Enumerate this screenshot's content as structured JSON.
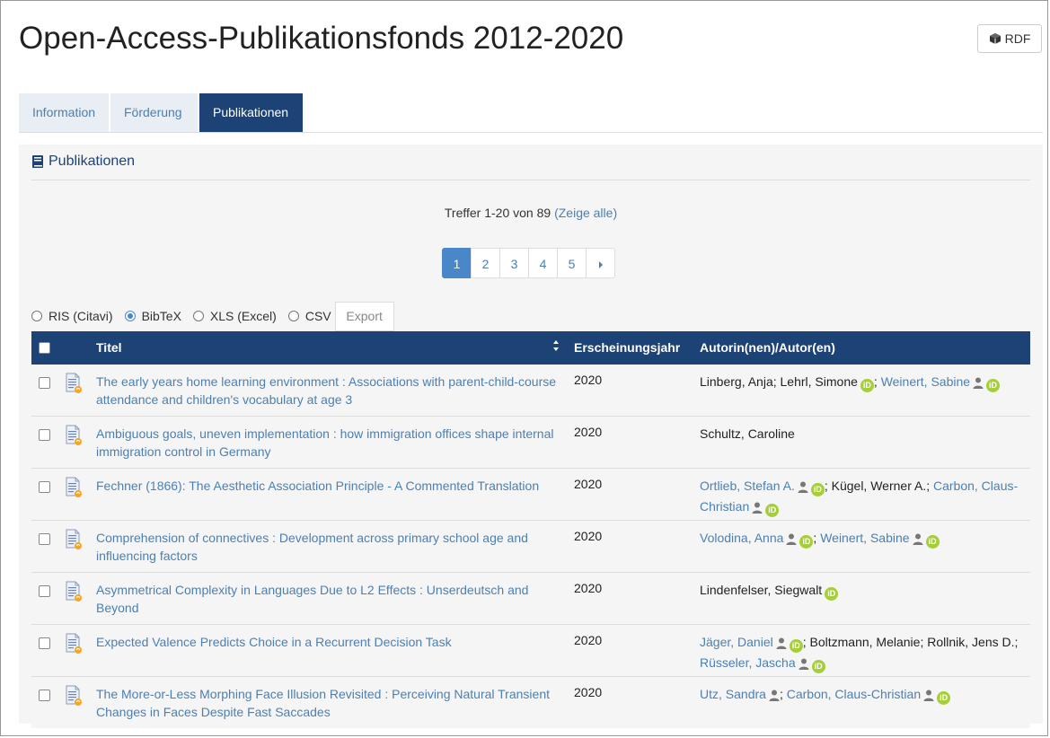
{
  "header": {
    "title": "Open-Access-Publikationsfonds 2012-2020",
    "rdf_label": "RDF"
  },
  "tabs": [
    {
      "label": "Information",
      "active": false
    },
    {
      "label": "Förderung",
      "active": false
    },
    {
      "label": "Publikationen",
      "active": true
    }
  ],
  "panel": {
    "heading": "Publikationen",
    "hits_text": "Treffer 1-20 von 89",
    "show_all": "(Zeige alle)"
  },
  "pagination": {
    "pages": [
      "1",
      "2",
      "3",
      "4",
      "5"
    ],
    "current": "1",
    "next_icon": "caret-right-icon"
  },
  "export": {
    "options": [
      "RIS (Citavi)",
      "BibTeX",
      "XLS (Excel)",
      "CSV"
    ],
    "selected": "BibTeX",
    "button_label": "Export"
  },
  "table": {
    "columns": [
      "Titel",
      "Erscheinungsjahr",
      "Autorin(nen)/Autor(en)"
    ],
    "rows": [
      {
        "title": "The early years home learning environment : Associations with parent-child-course attendance and children's vocabulary at age 3",
        "year": "2020",
        "authors": [
          {
            "name": "Linberg, Anja",
            "link": false,
            "person": false,
            "orcid": false
          },
          {
            "name": "Lehrl, Simone",
            "link": false,
            "person": false,
            "orcid": true
          },
          {
            "name": "Weinert, Sabine",
            "link": true,
            "person": true,
            "orcid": true
          }
        ]
      },
      {
        "title": "Ambiguous goals, uneven implementation : how immigration offices shape internal immigration control in Germany",
        "year": "2020",
        "authors": [
          {
            "name": "Schultz, Caroline",
            "link": false,
            "person": false,
            "orcid": false
          }
        ]
      },
      {
        "title": "Fechner (1866): The Aesthetic Association Principle - A Commented Translation",
        "year": "2020",
        "authors": [
          {
            "name": "Ortlieb, Stefan A.",
            "link": true,
            "person": true,
            "orcid": true
          },
          {
            "name": "Kügel, Werner A.",
            "link": false,
            "person": false,
            "orcid": false
          },
          {
            "name": "Carbon, Claus-Christian",
            "link": true,
            "person": true,
            "orcid": true
          }
        ]
      },
      {
        "title": "Comprehension of connectives : Development across primary school age and influencing factors",
        "year": "2020",
        "authors": [
          {
            "name": "Volodina, Anna",
            "link": true,
            "person": true,
            "orcid": true
          },
          {
            "name": "Weinert, Sabine",
            "link": true,
            "person": true,
            "orcid": true
          }
        ]
      },
      {
        "title": "Asymmetrical Complexity in Languages Due to L2 Effects : Unserdeutsch and Beyond",
        "year": "2020",
        "authors": [
          {
            "name": "Lindenfelser, Siegwalt",
            "link": false,
            "person": false,
            "orcid": true
          }
        ]
      },
      {
        "title": "Expected Valence Predicts Choice in a Recurrent Decision Task",
        "year": "2020",
        "authors": [
          {
            "name": "Jäger, Daniel",
            "link": true,
            "person": true,
            "orcid": true
          },
          {
            "name": "Boltzmann, Melanie",
            "link": false,
            "person": false,
            "orcid": false
          },
          {
            "name": "Rollnik, Jens D.",
            "link": false,
            "person": false,
            "orcid": false
          },
          {
            "name": "Rüsseler, Jascha",
            "link": true,
            "person": true,
            "orcid": true
          }
        ]
      },
      {
        "title": "The More-or-Less Morphing Face Illusion Revisited : Perceiving Natural Transient Changes in Faces Despite Fast Saccades",
        "year": "2020",
        "authors": [
          {
            "name": "Utz, Sandra",
            "link": true,
            "person": true,
            "orcid": false
          },
          {
            "name": "Carbon, Claus-Christian",
            "link": true,
            "person": true,
            "orcid": true
          }
        ]
      }
    ]
  },
  "orcid_label": "iD",
  "colors": {
    "primary": "#1d4275",
    "link": "#4a80b4",
    "tab_inactive_bg": "#e8eef4",
    "pager_active": "#4a87c8",
    "orcid": "#a6ce39"
  }
}
